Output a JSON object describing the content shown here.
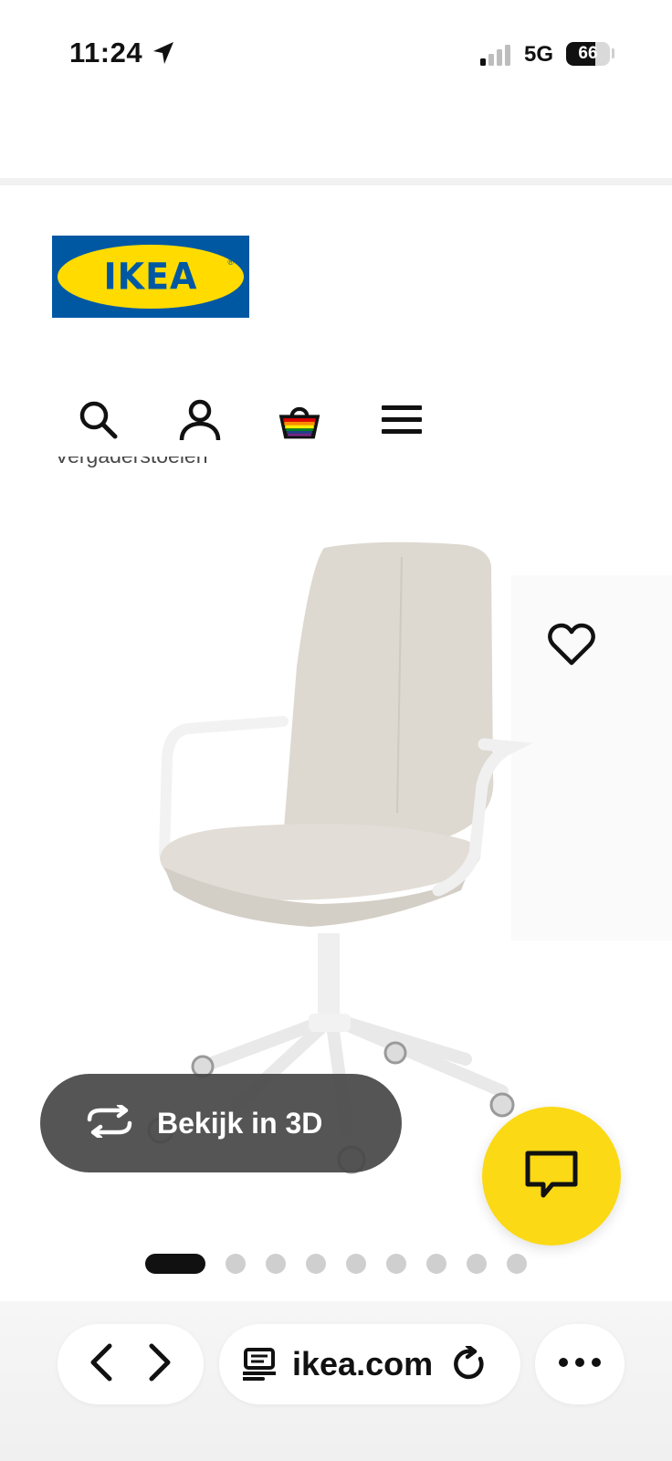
{
  "status_bar": {
    "time": "11:24",
    "network": "5G",
    "battery_level": "66",
    "icons": [
      "location-arrow-icon",
      "signal-bars-icon",
      "battery-icon"
    ]
  },
  "brand": {
    "logo_text": "IKEA",
    "colors": {
      "blue": "#0058a3",
      "yellow": "#ffdb00"
    }
  },
  "nav": {
    "icons": [
      "search-icon",
      "account-icon",
      "shopping-bag-icon",
      "menu-icon"
    ]
  },
  "breadcrumb_partial": "Vergaderstoelen",
  "product": {
    "image": "office-chair-beige-white",
    "view_3d_label": "Bekijk in 3D",
    "gallery": {
      "total": 9,
      "active_index": 0
    }
  },
  "chat": {
    "icon": "chat-bubble-icon",
    "color": "#fbd914"
  },
  "browser": {
    "url": "ikea.com",
    "icons": [
      "back-icon",
      "forward-icon",
      "reader-icon",
      "reload-icon",
      "more-icon"
    ]
  }
}
